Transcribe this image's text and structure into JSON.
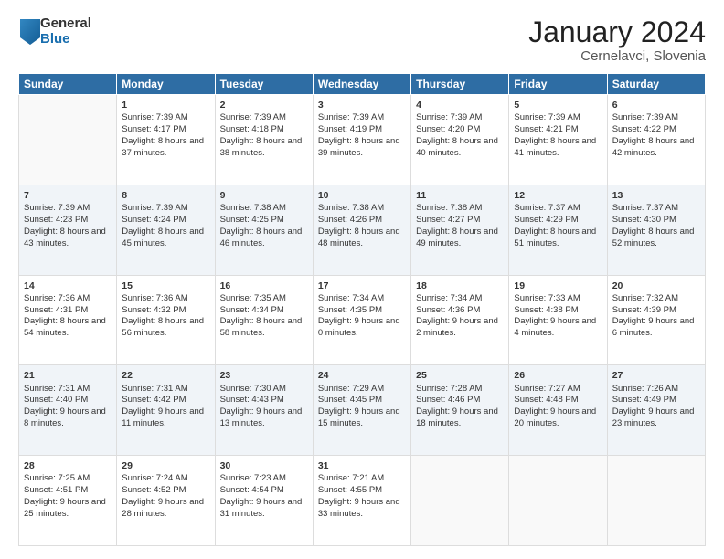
{
  "logo": {
    "general": "General",
    "blue": "Blue"
  },
  "title": "January 2024",
  "subtitle": "Cernelavci, Slovenia",
  "days": [
    "Sunday",
    "Monday",
    "Tuesday",
    "Wednesday",
    "Thursday",
    "Friday",
    "Saturday"
  ],
  "weeks": [
    [
      {
        "num": "",
        "sunrise": "",
        "sunset": "",
        "daylight": ""
      },
      {
        "num": "1",
        "sunrise": "Sunrise: 7:39 AM",
        "sunset": "Sunset: 4:17 PM",
        "daylight": "Daylight: 8 hours and 37 minutes."
      },
      {
        "num": "2",
        "sunrise": "Sunrise: 7:39 AM",
        "sunset": "Sunset: 4:18 PM",
        "daylight": "Daylight: 8 hours and 38 minutes."
      },
      {
        "num": "3",
        "sunrise": "Sunrise: 7:39 AM",
        "sunset": "Sunset: 4:19 PM",
        "daylight": "Daylight: 8 hours and 39 minutes."
      },
      {
        "num": "4",
        "sunrise": "Sunrise: 7:39 AM",
        "sunset": "Sunset: 4:20 PM",
        "daylight": "Daylight: 8 hours and 40 minutes."
      },
      {
        "num": "5",
        "sunrise": "Sunrise: 7:39 AM",
        "sunset": "Sunset: 4:21 PM",
        "daylight": "Daylight: 8 hours and 41 minutes."
      },
      {
        "num": "6",
        "sunrise": "Sunrise: 7:39 AM",
        "sunset": "Sunset: 4:22 PM",
        "daylight": "Daylight: 8 hours and 42 minutes."
      }
    ],
    [
      {
        "num": "7",
        "sunrise": "Sunrise: 7:39 AM",
        "sunset": "Sunset: 4:23 PM",
        "daylight": "Daylight: 8 hours and 43 minutes."
      },
      {
        "num": "8",
        "sunrise": "Sunrise: 7:39 AM",
        "sunset": "Sunset: 4:24 PM",
        "daylight": "Daylight: 8 hours and 45 minutes."
      },
      {
        "num": "9",
        "sunrise": "Sunrise: 7:38 AM",
        "sunset": "Sunset: 4:25 PM",
        "daylight": "Daylight: 8 hours and 46 minutes."
      },
      {
        "num": "10",
        "sunrise": "Sunrise: 7:38 AM",
        "sunset": "Sunset: 4:26 PM",
        "daylight": "Daylight: 8 hours and 48 minutes."
      },
      {
        "num": "11",
        "sunrise": "Sunrise: 7:38 AM",
        "sunset": "Sunset: 4:27 PM",
        "daylight": "Daylight: 8 hours and 49 minutes."
      },
      {
        "num": "12",
        "sunrise": "Sunrise: 7:37 AM",
        "sunset": "Sunset: 4:29 PM",
        "daylight": "Daylight: 8 hours and 51 minutes."
      },
      {
        "num": "13",
        "sunrise": "Sunrise: 7:37 AM",
        "sunset": "Sunset: 4:30 PM",
        "daylight": "Daylight: 8 hours and 52 minutes."
      }
    ],
    [
      {
        "num": "14",
        "sunrise": "Sunrise: 7:36 AM",
        "sunset": "Sunset: 4:31 PM",
        "daylight": "Daylight: 8 hours and 54 minutes."
      },
      {
        "num": "15",
        "sunrise": "Sunrise: 7:36 AM",
        "sunset": "Sunset: 4:32 PM",
        "daylight": "Daylight: 8 hours and 56 minutes."
      },
      {
        "num": "16",
        "sunrise": "Sunrise: 7:35 AM",
        "sunset": "Sunset: 4:34 PM",
        "daylight": "Daylight: 8 hours and 58 minutes."
      },
      {
        "num": "17",
        "sunrise": "Sunrise: 7:34 AM",
        "sunset": "Sunset: 4:35 PM",
        "daylight": "Daylight: 9 hours and 0 minutes."
      },
      {
        "num": "18",
        "sunrise": "Sunrise: 7:34 AM",
        "sunset": "Sunset: 4:36 PM",
        "daylight": "Daylight: 9 hours and 2 minutes."
      },
      {
        "num": "19",
        "sunrise": "Sunrise: 7:33 AM",
        "sunset": "Sunset: 4:38 PM",
        "daylight": "Daylight: 9 hours and 4 minutes."
      },
      {
        "num": "20",
        "sunrise": "Sunrise: 7:32 AM",
        "sunset": "Sunset: 4:39 PM",
        "daylight": "Daylight: 9 hours and 6 minutes."
      }
    ],
    [
      {
        "num": "21",
        "sunrise": "Sunrise: 7:31 AM",
        "sunset": "Sunset: 4:40 PM",
        "daylight": "Daylight: 9 hours and 8 minutes."
      },
      {
        "num": "22",
        "sunrise": "Sunrise: 7:31 AM",
        "sunset": "Sunset: 4:42 PM",
        "daylight": "Daylight: 9 hours and 11 minutes."
      },
      {
        "num": "23",
        "sunrise": "Sunrise: 7:30 AM",
        "sunset": "Sunset: 4:43 PM",
        "daylight": "Daylight: 9 hours and 13 minutes."
      },
      {
        "num": "24",
        "sunrise": "Sunrise: 7:29 AM",
        "sunset": "Sunset: 4:45 PM",
        "daylight": "Daylight: 9 hours and 15 minutes."
      },
      {
        "num": "25",
        "sunrise": "Sunrise: 7:28 AM",
        "sunset": "Sunset: 4:46 PM",
        "daylight": "Daylight: 9 hours and 18 minutes."
      },
      {
        "num": "26",
        "sunrise": "Sunrise: 7:27 AM",
        "sunset": "Sunset: 4:48 PM",
        "daylight": "Daylight: 9 hours and 20 minutes."
      },
      {
        "num": "27",
        "sunrise": "Sunrise: 7:26 AM",
        "sunset": "Sunset: 4:49 PM",
        "daylight": "Daylight: 9 hours and 23 minutes."
      }
    ],
    [
      {
        "num": "28",
        "sunrise": "Sunrise: 7:25 AM",
        "sunset": "Sunset: 4:51 PM",
        "daylight": "Daylight: 9 hours and 25 minutes."
      },
      {
        "num": "29",
        "sunrise": "Sunrise: 7:24 AM",
        "sunset": "Sunset: 4:52 PM",
        "daylight": "Daylight: 9 hours and 28 minutes."
      },
      {
        "num": "30",
        "sunrise": "Sunrise: 7:23 AM",
        "sunset": "Sunset: 4:54 PM",
        "daylight": "Daylight: 9 hours and 31 minutes."
      },
      {
        "num": "31",
        "sunrise": "Sunrise: 7:21 AM",
        "sunset": "Sunset: 4:55 PM",
        "daylight": "Daylight: 9 hours and 33 minutes."
      },
      {
        "num": "",
        "sunrise": "",
        "sunset": "",
        "daylight": ""
      },
      {
        "num": "",
        "sunrise": "",
        "sunset": "",
        "daylight": ""
      },
      {
        "num": "",
        "sunrise": "",
        "sunset": "",
        "daylight": ""
      }
    ]
  ]
}
